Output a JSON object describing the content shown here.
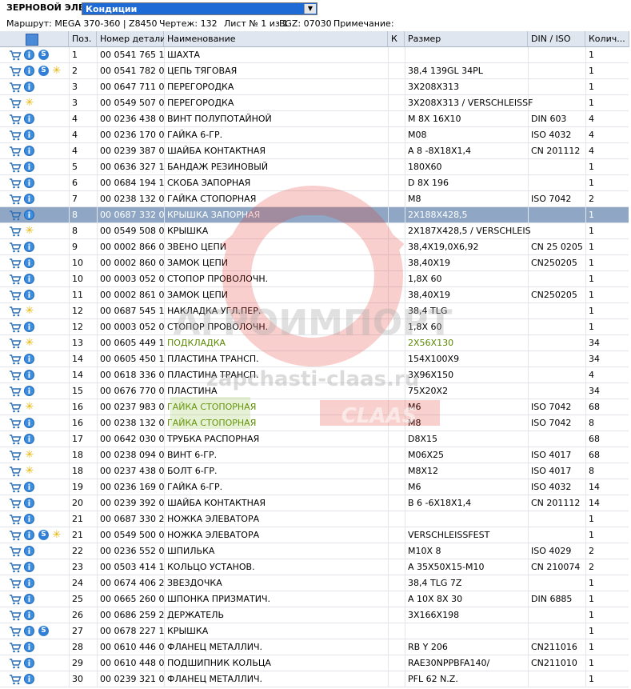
{
  "header": {
    "title": "ЗЕРНОВОЙ ЭЛЕВ",
    "select_value": "Кондиции"
  },
  "info": {
    "route": "Маршрут: MEGA 370-360 | Z8450",
    "drawing": "Чертеж: 132",
    "sheet": "Лист № 1 из 1",
    "bgz": "BGZ: 07030",
    "note": "Примечание:"
  },
  "columns": {
    "pos": "Поз.",
    "part": "Номер детали",
    "name": "Наименование",
    "k": "К",
    "size": "Размер",
    "din": "DIN / ISO",
    "qty": "Колич..."
  },
  "watermark": {
    "brand": "АГРОИМПОРТ",
    "site": "zapchasti-claas.ru",
    "logo": "CLAAS"
  },
  "colors": {
    "selected_row": "#8fa7c4",
    "header_bg": "#dfe6ef",
    "select_bg": "#1f6bd6",
    "green_text": "#5b8a00"
  },
  "rows": [
    {
      "pos": "1",
      "part": "00 0541 765 1",
      "name": "ШАХТА",
      "size": "",
      "din": "",
      "qty": "1",
      "icons": [
        "cart",
        "info",
        "s"
      ]
    },
    {
      "pos": "2",
      "part": "00 0541 782 0",
      "name": "ЦЕПЬ ТЯГОВАЯ",
      "size": "38,4 139GL 34PL",
      "din": "",
      "qty": "1",
      "icons": [
        "cart",
        "info",
        "s",
        "star"
      ]
    },
    {
      "pos": "3",
      "part": "00 0647 711 0",
      "name": "ПЕРЕГОРОДКА",
      "size": "3X208X313",
      "din": "",
      "qty": "1",
      "icons": [
        "cart",
        "info"
      ]
    },
    {
      "pos": "3",
      "part": "00 0549 507 0",
      "name": "ПЕРЕГОРОДКА",
      "size": "3X208X313 / VERSCHLEISSF",
      "din": "",
      "qty": "1",
      "icons": [
        "cart",
        "star"
      ]
    },
    {
      "pos": "4",
      "part": "00 0236 438 0",
      "name": "ВИНТ ПОЛУПОТАЙНОЙ",
      "size": "M 8X 16X10",
      "din": "DIN 603",
      "qty": "4",
      "icons": [
        "cart",
        "info"
      ]
    },
    {
      "pos": "4",
      "part": "00 0236 170 0",
      "name": "ГАЙКА 6-ГР.",
      "size": "M08",
      "din": "ISO 4032",
      "qty": "4",
      "icons": [
        "cart",
        "info"
      ]
    },
    {
      "pos": "4",
      "part": "00 0239 387 0",
      "name": "ШАЙБА КОНТАКТНАЯ",
      "size": "A 8 -8X18X1,4",
      "din": "CN 201112",
      "qty": "4",
      "icons": [
        "cart",
        "info"
      ]
    },
    {
      "pos": "5",
      "part": "00 0636 327 1",
      "name": "БАНДАЖ РЕЗИНОВЫЙ",
      "size": "180X60",
      "din": "",
      "qty": "1",
      "icons": [
        "cart",
        "info"
      ]
    },
    {
      "pos": "6",
      "part": "00 0684 194 1",
      "name": "СКОБА ЗАПОРНАЯ",
      "size": "D 8X 196",
      "din": "",
      "qty": "1",
      "icons": [
        "cart",
        "info"
      ]
    },
    {
      "pos": "7",
      "part": "00 0238 132 0",
      "name": "ГАЙКА СТОПОРНАЯ",
      "size": "M8",
      "din": "ISO 7042",
      "qty": "2",
      "icons": [
        "cart",
        "info"
      ]
    },
    {
      "pos": "8",
      "part": "00 0687 332 0",
      "name": "КРЫШКА ЗАПОРНАЯ",
      "size": "2X188X428,5",
      "din": "",
      "qty": "1",
      "icons": [
        "cart",
        "info"
      ],
      "selected": true
    },
    {
      "pos": "8",
      "part": "00 0549 508 0",
      "name": "КРЫШКА",
      "size": "2X187X428,5 / VERSCHLEIS",
      "din": "",
      "qty": "1",
      "icons": [
        "cart",
        "star"
      ]
    },
    {
      "pos": "9",
      "part": "00 0002 866 0",
      "name": "ЗВЕНО ЦЕПИ",
      "size": "38,4X19,0X6,92",
      "din": "CN 25 0205",
      "qty": "1",
      "icons": [
        "cart",
        "info"
      ]
    },
    {
      "pos": "10",
      "part": "00 0002 860 0",
      "name": "ЗАМОК ЦЕПИ",
      "size": "38,40X19",
      "din": "CN250205",
      "qty": "1",
      "icons": [
        "cart",
        "info"
      ]
    },
    {
      "pos": "10",
      "part": "00 0003 052 0",
      "name": "СТОПОР ПРОВОЛОЧН.",
      "size": "1,8X 60",
      "din": "",
      "qty": "1",
      "icons": [
        "cart",
        "info"
      ]
    },
    {
      "pos": "11",
      "part": "00 0002 861 0",
      "name": "ЗАМОК ЦЕПИ",
      "size": "38,40X19",
      "din": "CN250205",
      "qty": "1",
      "icons": [
        "cart",
        "info"
      ]
    },
    {
      "pos": "12",
      "part": "00 0687 545 1",
      "name": "НАКЛАДКА УГЛ.ПЕР.",
      "size": "38,4  TLG",
      "din": "",
      "qty": "1",
      "icons": [
        "cart",
        "star"
      ]
    },
    {
      "pos": "12",
      "part": "00 0003 052 0",
      "name": "СТОПОР ПРОВОЛОЧН.",
      "size": "1,8X 60",
      "din": "",
      "qty": "1",
      "icons": [
        "cart",
        "info"
      ]
    },
    {
      "pos": "13",
      "part": "00 0605 449 1",
      "name": "ПОДКЛАДКА",
      "size": "2X56X130",
      "din": "",
      "qty": "34",
      "icons": [
        "cart",
        "star"
      ],
      "green": true
    },
    {
      "pos": "14",
      "part": "00 0605 450 1",
      "name": "ПЛАСТИНА ТРАНСП.",
      "size": "154X100X9",
      "din": "",
      "qty": "34",
      "icons": [
        "cart",
        "info"
      ]
    },
    {
      "pos": "14",
      "part": "00 0618 336 0",
      "name": "ПЛАСТИНА ТРАНСП.",
      "size": "3X96X150",
      "din": "",
      "qty": "4",
      "icons": [
        "cart",
        "info"
      ]
    },
    {
      "pos": "15",
      "part": "00 0676 770 0",
      "name": "ПЛАСТИНА",
      "size": "75X20X2",
      "din": "",
      "qty": "34",
      "icons": [
        "cart",
        "info"
      ]
    },
    {
      "pos": "16",
      "part": "00 0237 983 0",
      "name": "ГАЙКА СТОПОРНАЯ",
      "size": "M6",
      "din": "ISO 7042",
      "qty": "68",
      "icons": [
        "cart",
        "star"
      ],
      "green": true
    },
    {
      "pos": "16",
      "part": "00 0238 132 0",
      "name": "ГАЙКА СТОПОРНАЯ",
      "size": "M8",
      "din": "ISO 7042",
      "qty": "8",
      "icons": [
        "cart",
        "info"
      ],
      "green": true
    },
    {
      "pos": "17",
      "part": "00 0642 030 0",
      "name": "ТРУБКА РАСПОРНАЯ",
      "size": "D8X15",
      "din": "",
      "qty": "68",
      "icons": [
        "cart",
        "info"
      ]
    },
    {
      "pos": "18",
      "part": "00 0238 094 0",
      "name": "ВИНТ 6-ГР.",
      "size": "M06X25",
      "din": "ISO 4017",
      "qty": "68",
      "icons": [
        "cart",
        "star"
      ]
    },
    {
      "pos": "18",
      "part": "00 0237 438 0",
      "name": "БОЛТ 6-ГР.",
      "size": "M8X12",
      "din": "ISO 4017",
      "qty": "8",
      "icons": [
        "cart",
        "star"
      ]
    },
    {
      "pos": "19",
      "part": "00 0236 169 0",
      "name": "ГАЙКА 6-ГР.",
      "size": "M6",
      "din": "ISO 4032",
      "qty": "14",
      "icons": [
        "cart",
        "info"
      ]
    },
    {
      "pos": "20",
      "part": "00 0239 392 0",
      "name": "ШАЙБА КОНТАКТНАЯ",
      "size": "B 6 -6X18X1,4",
      "din": "CN 201112",
      "qty": "14",
      "icons": [
        "cart",
        "info"
      ]
    },
    {
      "pos": "21",
      "part": "00 0687 330 2",
      "name": "НОЖКА ЭЛЕВАТОРА",
      "size": "",
      "din": "",
      "qty": "1",
      "icons": [
        "cart",
        "info"
      ]
    },
    {
      "pos": "21",
      "part": "00 0549 500 0",
      "name": "НОЖКА ЭЛЕВАТОРА",
      "size": "VERSCHLEISSFEST",
      "din": "",
      "qty": "1",
      "icons": [
        "cart",
        "info",
        "s",
        "star"
      ]
    },
    {
      "pos": "22",
      "part": "00 0236 552 0",
      "name": "ШПИЛЬКА",
      "size": "M10X 8",
      "din": "ISO 4029",
      "qty": "2",
      "icons": [
        "cart",
        "info"
      ]
    },
    {
      "pos": "23",
      "part": "00 0503 414 1",
      "name": "КОЛЬЦО УСТАНОВ.",
      "size": "A 35X50X15-M10",
      "din": "CN 210074",
      "qty": "2",
      "icons": [
        "cart",
        "info"
      ]
    },
    {
      "pos": "24",
      "part": "00 0674 406 2",
      "name": "ЗВЕЗДОЧКА",
      "size": "38,4  TLG    7Z",
      "din": "",
      "qty": "1",
      "icons": [
        "cart",
        "info"
      ]
    },
    {
      "pos": "25",
      "part": "00 0665 260 0",
      "name": "ШПОНКА ПРИЗМАТИЧ.",
      "size": "A 10X 8X 30",
      "din": "DIN 6885",
      "qty": "1",
      "icons": [
        "cart",
        "info"
      ]
    },
    {
      "pos": "26",
      "part": "00 0686 259 2",
      "name": "ДЕРЖАТЕЛЬ",
      "size": "3X166X198",
      "din": "",
      "qty": "1",
      "icons": [
        "cart",
        "info"
      ]
    },
    {
      "pos": "27",
      "part": "00 0678 227 1",
      "name": "КРЫШКА",
      "size": "",
      "din": "",
      "qty": "1",
      "icons": [
        "cart",
        "info",
        "s"
      ]
    },
    {
      "pos": "28",
      "part": "00 0610 446 0",
      "name": "ФЛАНЕЦ МЕТАЛЛИЧ.",
      "size": "RB Y 206",
      "din": "CN211016",
      "qty": "1",
      "icons": [
        "cart",
        "info"
      ]
    },
    {
      "pos": "29",
      "part": "00 0610 448 0",
      "name": "ПОДШИПНИК КОЛЬЦА",
      "size": "RAE30NPPBFA140/",
      "din": "CN211010",
      "qty": "1",
      "icons": [
        "cart",
        "info"
      ]
    },
    {
      "pos": "30",
      "part": "00 0239 321 0",
      "name": "ФЛАНЕЦ МЕТАЛЛИЧ.",
      "size": "PFL 62 N.Z.",
      "din": "",
      "qty": "1",
      "icons": [
        "cart",
        "info"
      ]
    }
  ]
}
